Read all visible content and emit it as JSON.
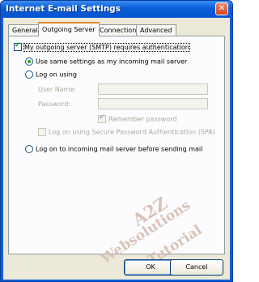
{
  "window": {
    "title": "Internet E-mail Settings",
    "close_glyph": "✕"
  },
  "tabs": [
    {
      "label": "General"
    },
    {
      "label": "Outgoing Server"
    },
    {
      "label": "Connection"
    },
    {
      "label": "Advanced"
    }
  ],
  "active_tab": "Outgoing Server",
  "outgoing": {
    "requires_auth_label": "My outgoing server (SMTP) requires authentication",
    "requires_auth_checked": true,
    "use_same_label": "Use same settings as my incoming mail server",
    "log_on_using_label": "Log on using",
    "user_name_label": "User Name:",
    "user_name_value": "",
    "password_label": "Password:",
    "password_value": "",
    "remember_password_label": "Remember password",
    "remember_password_checked": true,
    "spa_label": "Log on using Secure Password Authentication (SPA)",
    "spa_checked": false,
    "log_on_before_label": "Log on to incoming mail server before sending mail",
    "selected_option": "use_same"
  },
  "watermark": {
    "line1": "A2Z",
    "line2": "Websolutions",
    "line3": "Tutorial",
    "color": "#d9c3b8"
  },
  "buttons": {
    "ok": "OK",
    "cancel": "Cancel"
  }
}
